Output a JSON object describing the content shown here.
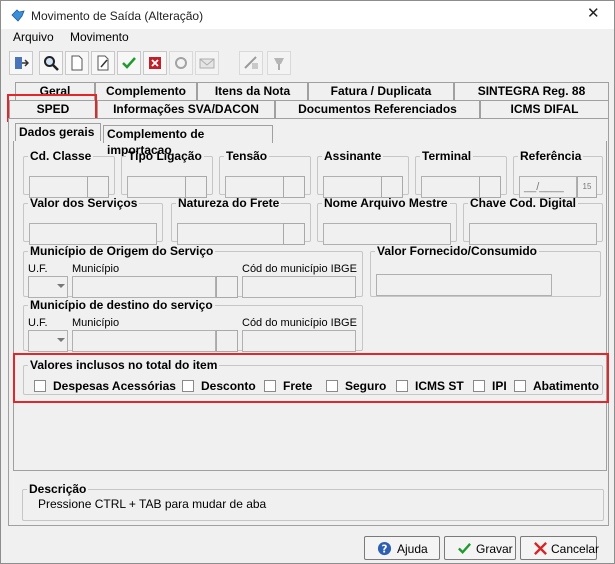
{
  "window": {
    "title": "Movimento de Saída (Alteração)",
    "close_glyph": "✕"
  },
  "menu": [
    {
      "label": "Arquivo"
    },
    {
      "label": "Movimento"
    }
  ],
  "toolbar_icons": [
    "exit-icon",
    "search-icon",
    "new-document-icon",
    "edit-icon",
    "check-icon",
    "delete-icon",
    "refresh-icon",
    "email-icon",
    "calculator-icon",
    "pin-icon"
  ],
  "tabs_row1": [
    "Geral",
    "Complemento",
    "Itens da Nota",
    "Fatura / Duplicata",
    "SINTEGRA Reg. 88"
  ],
  "tabs_row2": [
    "SPED",
    "Informações SVA/DACON",
    "Documentos Referenciados",
    "ICMS DIFAL"
  ],
  "subtabs": [
    "Dados gerais",
    "Complemento de importacao"
  ],
  "groups": {
    "cd_classe": "Cd. Classe",
    "tipo_ligacao": "Tipo Ligação",
    "tensao": "Tensão",
    "assinante": "Assinante",
    "terminal": "Terminal",
    "referencia": "Referência",
    "referencia_value": "__/____",
    "referencia_btn": "15",
    "valor_servicos": "Valor dos Serviços",
    "natureza_frete": "Natureza do Frete",
    "nome_arquivo": "Nome Arquivo Mestre",
    "chave_cod": "Chave Cod. Digital",
    "municipio_origem": "Município de Origem do Serviço",
    "municipio_destino": "Município de destino do serviço",
    "valor_fornecido": "Valor Fornecido/Consumido",
    "uf": "U.F.",
    "municipio": "Município",
    "cod_ibge": "Cód do município IBGE",
    "valores_inclusos": "Valores inclusos no total do item"
  },
  "checkboxes": [
    "Despesas Acessórias",
    "Desconto",
    "Frete",
    "Seguro",
    "ICMS ST",
    "IPI",
    "Abatimento"
  ],
  "descricao": {
    "title": "Descrição",
    "text": "Pressione CTRL + TAB para  mudar de aba"
  },
  "buttons": {
    "ajuda": "Ajuda",
    "gravar": "Gravar",
    "cancelar": "Cancelar"
  },
  "colors": {
    "highlight": "#e3262a",
    "window_bg": "#f0f0f0"
  }
}
